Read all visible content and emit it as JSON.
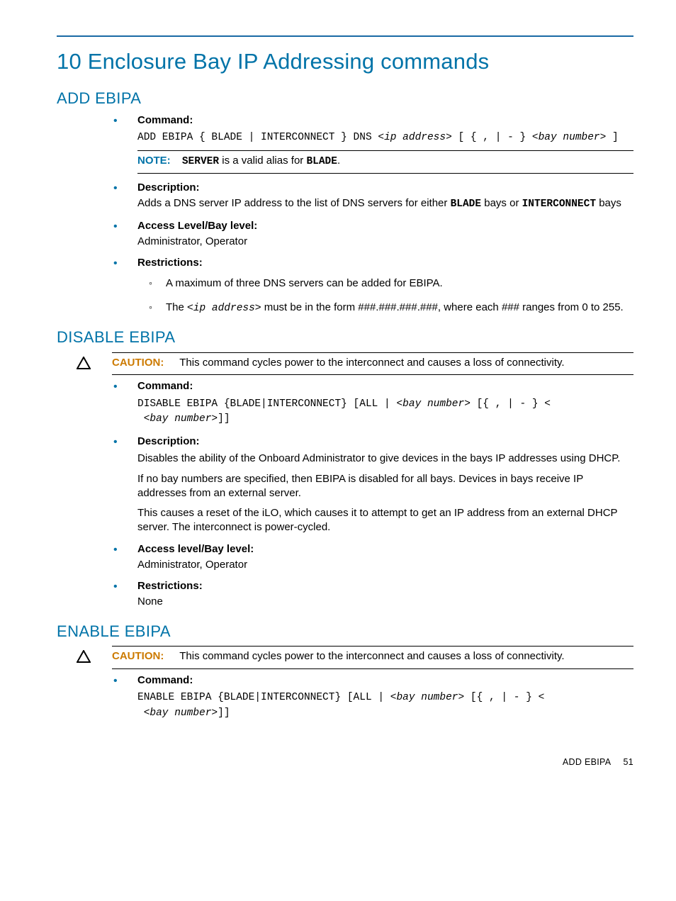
{
  "chapter_title": "10 Enclosure Bay IP Addressing commands",
  "sections": {
    "add": {
      "heading": "ADD EBIPA",
      "command_label": "Command:",
      "syntax_pre": "ADD EBIPA { BLADE | INTERCONNECT } DNS <",
      "syntax_ip": "ip address",
      "syntax_mid": "> [ { , | - } <",
      "syntax_bay": "bay number",
      "syntax_end": "> ]",
      "note_label": "NOTE:",
      "note_server": "SERVER",
      "note_mid": " is a valid alias for ",
      "note_blade": "BLADE",
      "note_end": ".",
      "desc_label": "Description:",
      "desc_pre": "Adds a DNS server IP address to the list of DNS servers for either ",
      "desc_blade": "BLADE",
      "desc_mid": " bays or ",
      "desc_inter": "INTERCONNECT",
      "desc_end": " bays",
      "access_label": "Access Level/Bay level:",
      "access_value": "Administrator, Operator",
      "restr_label": "Restrictions:",
      "restr1": "A maximum of three DNS servers can be added for EBIPA.",
      "restr2_pre": "The <",
      "restr2_ip": "ip address",
      "restr2_post": "> must be in the form ###.###.###.###, where each ### ranges from 0 to 255."
    },
    "disable": {
      "heading": "DISABLE EBIPA",
      "caution_label": "CAUTION:",
      "caution_text": "This command cycles power to the interconnect and causes a loss of connectivity.",
      "command_label": "Command:",
      "syntax_pre": "DISABLE EBIPA {BLADE|INTERCONNECT} [ALL | <",
      "syntax_bay1": "bay number",
      "syntax_mid": "> [{ , | - } <",
      "syntax_bay2": "bay number",
      "syntax_end": ">]]",
      "desc_label": "Description:",
      "desc1": "Disables the ability of the Onboard Administrator to give devices in the bays IP addresses using DHCP.",
      "desc2": "If no bay numbers are specified, then EBIPA is disabled for all bays. Devices in bays receive IP addresses from an external server.",
      "desc3": "This causes a reset of the iLO, which causes it to attempt to get an IP address from an external DHCP server. The interconnect is power-cycled.",
      "access_label": "Access level/Bay level:",
      "access_value": "Administrator, Operator",
      "restr_label": "Restrictions:",
      "restr_value": "None"
    },
    "enable": {
      "heading": "ENABLE EBIPA",
      "caution_label": "CAUTION:",
      "caution_text": "This command cycles power to the interconnect and causes a loss of connectivity.",
      "command_label": "Command:",
      "syntax_pre": "ENABLE EBIPA {BLADE|INTERCONNECT} [ALL | <",
      "syntax_bay1": "bay number",
      "syntax_mid": "> [{ , | - } <",
      "syntax_bay2": "bay number",
      "syntax_end": ">]]"
    }
  },
  "footer_section": "ADD EBIPA",
  "footer_page": "51"
}
